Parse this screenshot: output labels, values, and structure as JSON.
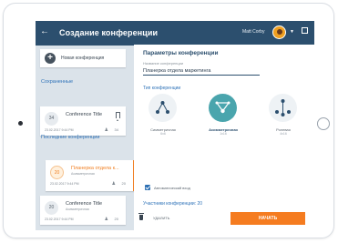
{
  "header": {
    "back_icon": "arrow-left-icon",
    "title": "Создание конференции",
    "user_name": "Matt Corby"
  },
  "sidebar": {
    "new_conference_label": "Новая конференция",
    "saved_section": "Сохраненные",
    "recent_section": "Последние конференции",
    "saved_items": [
      {
        "num": "34",
        "title": "Conference Title",
        "date": "23.02.2017 9:44 PM",
        "count": "34"
      }
    ],
    "recent_items": [
      {
        "num": "20",
        "title": "Планерка отдела к...",
        "subtitle": "Асимметричная",
        "date": "23.02.2017 9:44 PM",
        "count": "20"
      },
      {
        "num": "20",
        "title": "Conference Title",
        "subtitle": "Асимметричная",
        "date": "23.02.2017 9:44 PM",
        "count": "20"
      }
    ]
  },
  "panel": {
    "title": "Параметры конференции",
    "name_label": "Название конференции",
    "name_value": "Планерка отдела маркетинга",
    "type_label": "Тип конференции",
    "types": [
      {
        "label": "Симметричная",
        "sub": "6x6"
      },
      {
        "label": "Асимметричная",
        "sub": "1x16"
      },
      {
        "label": "Ролевая",
        "sub": "4x16"
      }
    ],
    "selected_type": "Асимметричная",
    "auto_entry_label": "Автоматический вход",
    "auto_entry_checked": true,
    "participants_label": "Участники конференции: 20",
    "change_label": "ИЗМЕНИТЬ",
    "avatar_colors": [
      "#f4a623",
      "#e36b2d",
      "#3a4652",
      "#7a5b8c",
      "#c05a3a",
      "#f4a623",
      "#46525e",
      "#e0a040",
      "#3a8aa0",
      "#6a7580",
      "#4aa5ad",
      "#5a6670"
    ]
  },
  "footer": {
    "delete_label": "УДАЛИТЬ",
    "start_label": "НАЧАТЬ"
  },
  "colors": {
    "header": "#2c4f6e",
    "accent": "#f57c20",
    "link": "#2e72b8",
    "selected_type": "#4aa5ad"
  }
}
